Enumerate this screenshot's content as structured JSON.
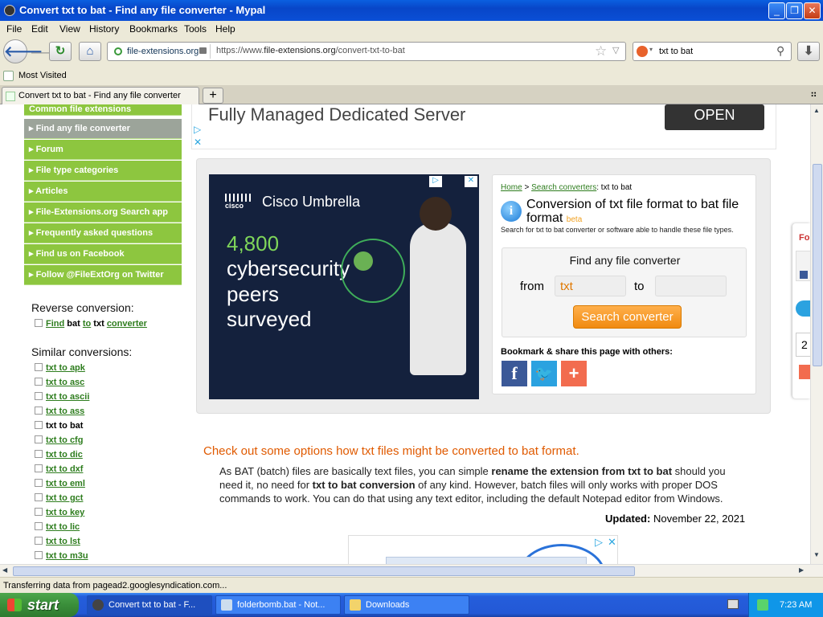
{
  "window": {
    "title": "Convert txt to bat - Find any file converter - Mypal"
  },
  "menu": [
    "File",
    "Edit",
    "View",
    "History",
    "Bookmarks",
    "Tools",
    "Help"
  ],
  "nav": {
    "site_identity": "file-extensions.org",
    "url_prefix": "https://www.",
    "url_domain": "file-extensions.org",
    "url_path": "/convert-txt-to-bat",
    "search_value": "txt to bat"
  },
  "bookmarks": {
    "most_visited": "Most Visited"
  },
  "tab": {
    "label": "Convert txt to bat - Find any file converter"
  },
  "sidebar": {
    "items": [
      "Common file extensions",
      "Find any file converter",
      "Forum",
      "File type categories",
      "Articles",
      "File-Extensions.org Search app",
      "Frequently asked questions",
      "Find us on Facebook",
      "Follow @FileExtOrg on Twitter"
    ],
    "reverse_heading": "Reverse conversion:",
    "reverse_link": {
      "a": "Find",
      "b": "bat",
      "c": "to",
      "d": "txt",
      "e": "converter"
    },
    "similar_heading": "Similar conversions:",
    "similar": [
      "txt to apk",
      "txt to asc",
      "txt to ascii",
      "txt to ass",
      "txt to bat",
      "txt to cfg",
      "txt to dic",
      "txt to dxf",
      "txt to eml",
      "txt to gct",
      "txt to key",
      "txt to lic",
      "txt to lst",
      "txt to m3u"
    ]
  },
  "ad_top": {
    "text": "Fully Managed Dedicated Server",
    "button": "OPEN"
  },
  "ad_cisco": {
    "brand": "Cisco Umbrella",
    "number": "4,800",
    "line1": "cybersecurity",
    "line2": "peers",
    "line3": "surveyed"
  },
  "converter": {
    "breadcrumb_home": "Home",
    "breadcrumb_sep1": ">",
    "breadcrumb_search": "Search converters",
    "breadcrumb_tail": ": txt to bat",
    "title": "Conversion of txt file format to bat file format",
    "beta": "beta",
    "description": "Search for txt to bat converter or software able to handle these file types.",
    "box_title": "Find any file converter",
    "from_label": "from",
    "from_value": "txt",
    "to_label": "to",
    "to_value": "",
    "search_button": "Search converter",
    "share_text": "Bookmark & share this page with others:"
  },
  "article": {
    "heading": "Check out some options how txt files might be converted to bat format.",
    "p1": "As BAT (batch) files are basically text files, you can simple",
    "p1_bold": "rename the extension from txt to bat",
    "p2": "should you need it, no need for",
    "p2_bold": "txt to bat conversion",
    "p3": "of any kind. However, batch files will only works with proper DOS commands to work. You can do that using any text editor, including the default Notepad editor from Windows.",
    "updated_label": "Updated:",
    "updated_date": "November 22, 2021"
  },
  "right_widget": {
    "label": "Fo",
    "number": "2"
  },
  "status": {
    "text": "Transferring data from pagead2.googlesyndication.com..."
  },
  "taskbar": {
    "start": "start",
    "tasks": [
      "Convert txt to bat - F...",
      "folderbomb.bat - Not...",
      "Downloads"
    ],
    "clock": "7:23 AM"
  },
  "colors": {
    "sidebar_green": "#8dc63f",
    "link_green": "#2e7d1e",
    "orange": "#f08a10",
    "heading_orange": "#e05a00"
  }
}
